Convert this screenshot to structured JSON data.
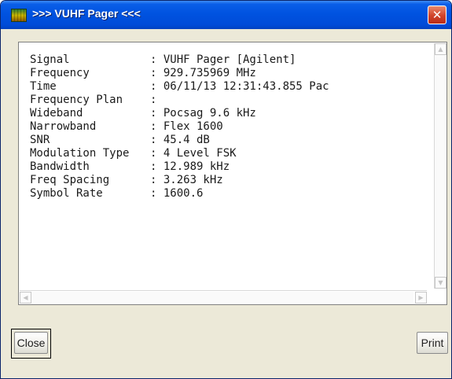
{
  "window": {
    "title": ">>> VUHF Pager <<<"
  },
  "info": [
    {
      "label": "Signal",
      "value": ": VUHF Pager [Agilent]"
    },
    {
      "label": "Frequency",
      "value": ": 929.735969 MHz"
    },
    {
      "label": "Time",
      "value": ": 06/11/13 12:31:43.855 Pac"
    },
    {
      "label": "Frequency Plan",
      "value": ":"
    },
    {
      "label": "Wideband",
      "value": ": Pocsag 9.6 kHz"
    },
    {
      "label": "Narrowband",
      "value": ": Flex 1600"
    },
    {
      "label": "SNR",
      "value": ": 45.4 dB"
    },
    {
      "label": "Modulation Type",
      "value": ": 4 Level FSK"
    },
    {
      "label": "Bandwidth",
      "value": ": 12.989 kHz"
    },
    {
      "label": "Freq Spacing",
      "value": ": 3.263 kHz"
    },
    {
      "label": "Symbol Rate",
      "value": ": 1600.6"
    }
  ],
  "buttons": {
    "close": "Close",
    "print": "Print"
  },
  "icons": {
    "app": "spectrum-icon",
    "title_close": "close-icon",
    "scroll_up": "arrow-up-icon",
    "scroll_down": "arrow-down-icon",
    "scroll_left": "arrow-left-icon",
    "scroll_right": "arrow-right-icon"
  },
  "colors": {
    "titlebar": "#0053e0",
    "close_button": "#d0422a",
    "window_bg": "#ece9d8"
  }
}
